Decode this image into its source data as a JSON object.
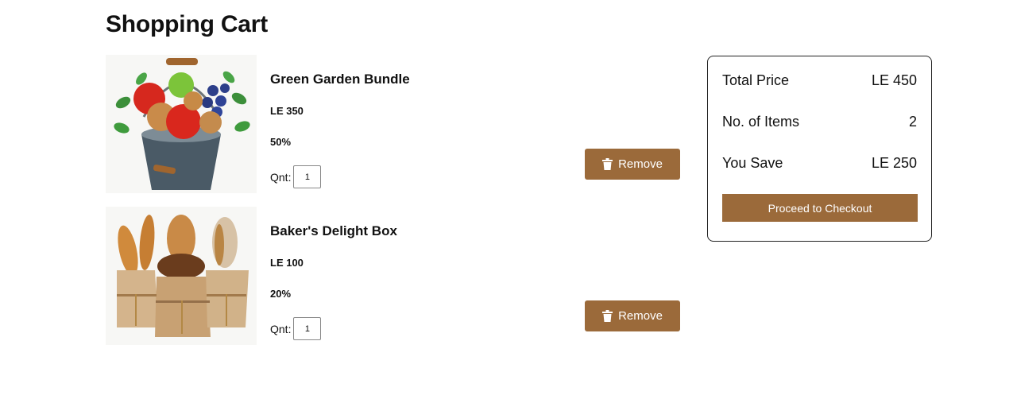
{
  "page": {
    "title": "Shopping Cart"
  },
  "cart": {
    "items": [
      {
        "name": "Green Garden Bundle",
        "price": "LE 350",
        "discount": "50%",
        "qty_label": "Qnt:",
        "qty_value": "1",
        "remove_label": "Remove",
        "image": "vegetable-basket-image"
      },
      {
        "name": "Baker's Delight Box",
        "price": "LE 100",
        "discount": "20%",
        "qty_label": "Qnt:",
        "qty_value": "1",
        "remove_label": "Remove",
        "image": "bread-bags-image"
      }
    ]
  },
  "summary": {
    "total_label": "Total Price",
    "total_value": "LE 450",
    "items_label": "No. of Items",
    "items_value": "2",
    "save_label": "You Save",
    "save_value": "LE 250",
    "checkout_label": "Proceed to Checkout"
  },
  "icons": {
    "remove": "trash-icon"
  },
  "colors": {
    "accent": "#9b6a3a",
    "text": "#111111",
    "border": "#222222",
    "background": "#ffffff"
  }
}
